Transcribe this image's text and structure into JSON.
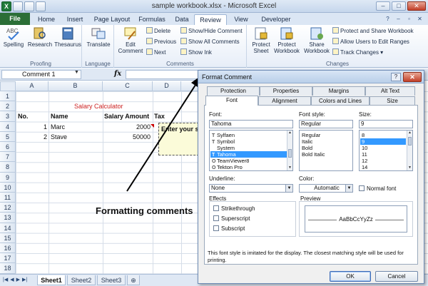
{
  "window": {
    "title": "sample workbook.xlsx - Microsoft Excel",
    "minimize": "–",
    "maximize": "□",
    "close": "✕"
  },
  "ribbon": {
    "file_tab": "File",
    "tabs": [
      "Home",
      "Insert",
      "Page Layout",
      "Formulas",
      "Data",
      "Review",
      "View",
      "Developer"
    ],
    "active_tab": "Review",
    "groups": {
      "proofing": {
        "label": "Proofing",
        "spelling": "Spelling",
        "research": "Research",
        "thesaurus": "Thesaurus"
      },
      "language": {
        "label": "Language",
        "translate": "Translate"
      },
      "comments": {
        "label": "Comments",
        "edit_comment_1": "Edit",
        "edit_comment_2": "Comment",
        "delete": "Delete",
        "previous": "Previous",
        "next": "Next",
        "show_hide": "Show/Hide Comment",
        "show_all": "Show All Comments",
        "show_ink": "Show Ink"
      },
      "changes": {
        "label": "Changes",
        "protect_sheet_1": "Protect",
        "protect_sheet_2": "Sheet",
        "protect_workbook_1": "Protect",
        "protect_workbook_2": "Workbook",
        "share_workbook_1": "Share",
        "share_workbook_2": "Workbook",
        "protect_share": "Protect and Share Workbook",
        "allow_users": "Allow Users to Edit Ranges",
        "track_changes": "Track Changes ▾"
      }
    }
  },
  "formula_bar": {
    "name_box": "Comment 1",
    "fx": "fx",
    "value": ""
  },
  "sheet": {
    "columns": [
      "A",
      "B",
      "C",
      "D"
    ],
    "rows": [
      "1",
      "2",
      "3",
      "4",
      "5",
      "6",
      "7",
      "8",
      "9",
      "10",
      "11",
      "12",
      "13",
      "14",
      "15",
      "16",
      "17",
      "18"
    ],
    "title": "Salary Calculator",
    "headers": [
      "No.",
      "Name",
      "Salary Amount",
      "Tax"
    ],
    "data": [
      {
        "no": "1",
        "name": "Marc",
        "salary": "2000"
      },
      {
        "no": "2",
        "name": "Stave",
        "salary": "50000"
      }
    ],
    "comment_text": "Enter your s",
    "tabs": [
      "Sheet1",
      "Sheet2",
      "Sheet3"
    ],
    "active_tab": "Sheet1"
  },
  "annotation": "Formatting comments",
  "dialog": {
    "title": "Format Comment",
    "help": "?",
    "close": "✕",
    "tabs_row1": [
      "Protection",
      "Properties",
      "Margins",
      "Alt Text"
    ],
    "tabs_row2": [
      "Font",
      "Alignment",
      "Colors and Lines",
      "Size"
    ],
    "active_tab": "Font",
    "font_label": "Font:",
    "font_value": "Tahoma",
    "font_list": [
      "Sylfaen",
      "Symbol",
      "System",
      "Tahoma",
      "TeamViewer8",
      "Tekton Pro"
    ],
    "font_selected": "Tahoma",
    "style_label": "Font style:",
    "style_value": "Regular",
    "style_list": [
      "Regular",
      "Italic",
      "Bold",
      "Bold Italic"
    ],
    "size_label": "Size:",
    "size_value": "9",
    "size_list": [
      "8",
      "9",
      "10",
      "11",
      "12",
      "14"
    ],
    "size_selected": "9",
    "underline_label": "Underline:",
    "underline_value": "None",
    "color_label": "Color:",
    "color_value": "Automatic",
    "normal_font": "Normal font",
    "effects_label": "Effects",
    "strikethrough": "Strikethrough",
    "superscript": "Superscript",
    "subscript": "Subscript",
    "preview_label": "Preview",
    "preview_text": "AaBbCcYyZz",
    "info": "This font style is imitated for the display.  The closest matching style will be used for printing.",
    "ok": "OK",
    "cancel": "Cancel"
  },
  "colors": {
    "file_tab": "#2b6e36",
    "title_red": "#cc2222",
    "selection": "#3399ff"
  }
}
